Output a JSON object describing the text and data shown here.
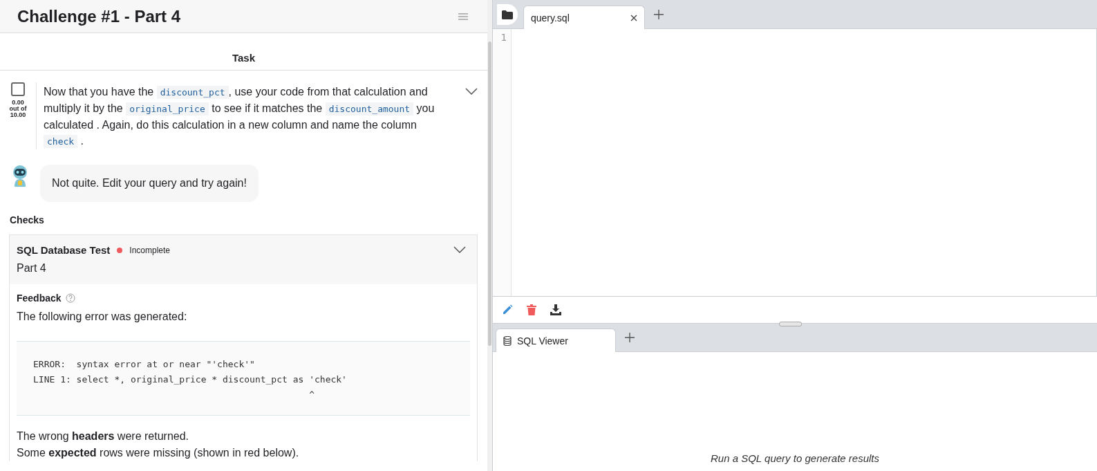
{
  "header": {
    "title": "Challenge #1 - Part 4"
  },
  "task": {
    "heading": "Task",
    "checked": false,
    "score": "0.00",
    "score_of": "out of",
    "score_max": "10.00",
    "instruction": [
      {
        "kind": "text",
        "text": "Now that you have the "
      },
      {
        "kind": "code",
        "text": "discount_pct"
      },
      {
        "kind": "text",
        "text": ", use your code from that calculation and multiply it by the "
      },
      {
        "kind": "code",
        "text": "original_price"
      },
      {
        "kind": "text",
        "text": " to see if it matches the "
      },
      {
        "kind": "code",
        "text": "discount_amount"
      },
      {
        "kind": "text",
        "text": " you calculated . Again, do this calculation in a new column and name the column "
      },
      {
        "kind": "code",
        "text": "check"
      },
      {
        "kind": "text",
        "text": " ."
      }
    ]
  },
  "assistant": {
    "message": "Not quite. Edit your query and try again!"
  },
  "checks": {
    "heading": "Checks",
    "items": [
      {
        "title": "SQL Database Test",
        "status": "Incomplete",
        "color": "#f05a5f",
        "subtitle": "Part 4",
        "feedback_label": "Feedback",
        "intro": "The following error was generated:",
        "error_lines": [
          "ERROR:  syntax error at or near \"'check'\"",
          "LINE 1: select *, original_price * discount_pct as 'check'",
          "                                                   ^"
        ],
        "notes": [
          "The wrong **headers** were returned.",
          "Some **expected** rows were missing (shown in red below)."
        ]
      }
    ]
  },
  "editor": {
    "tabs": [
      {
        "label": "query.sql",
        "selected": true
      }
    ],
    "line_numbers": [
      "1"
    ]
  },
  "results": {
    "tabs": [
      {
        "label": "SQL Viewer",
        "selected": true
      }
    ],
    "empty_message": "Run a SQL query to generate results"
  }
}
